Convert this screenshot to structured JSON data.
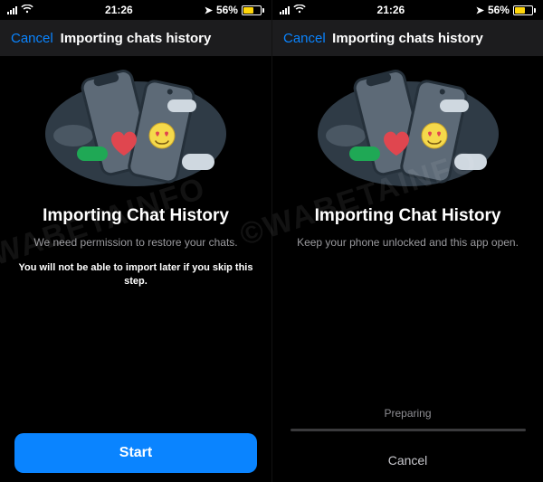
{
  "status": {
    "time": "21:26",
    "battery_pct": "56%",
    "wifi_icon": "wifi",
    "location_icon": "location"
  },
  "nav": {
    "cancel": "Cancel",
    "title": "Importing chats history"
  },
  "screen_a": {
    "heading": "Importing Chat History",
    "subtitle": "We need permission to restore your chats.",
    "warning": "You will not be able to import later if you skip this step.",
    "start_button": "Start"
  },
  "screen_b": {
    "heading": "Importing Chat History",
    "subtitle": "Keep your phone unlocked and this app open.",
    "preparing_label": "Preparing",
    "cancel_below": "Cancel",
    "progress_pct": 0
  },
  "watermark": "©WABETAINFO"
}
